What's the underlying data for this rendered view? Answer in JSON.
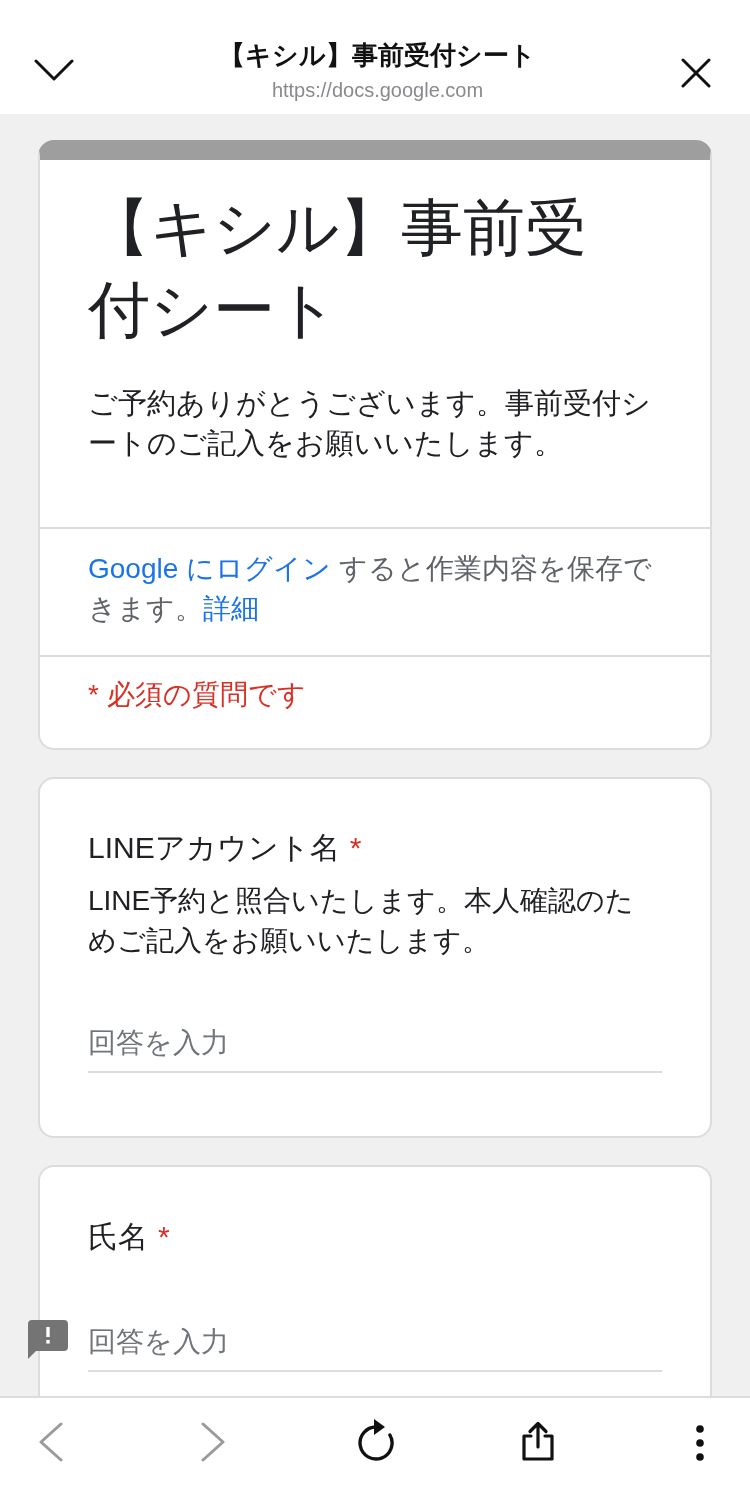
{
  "browser_bar": {
    "page_title": "【キシル】事前受付シート",
    "url": "https://docs.google.com"
  },
  "form_header": {
    "title": "【キシル】事前受付シート",
    "description": "ご予約ありがとうございます。事前受付シートのご記入をお願いいたします。",
    "login_notice": [
      {
        "kind": "link",
        "text": "Google にログイン"
      },
      {
        "kind": "text",
        "text": " すると作業内容を保存できます。"
      },
      {
        "kind": "link",
        "text": "詳細"
      }
    ],
    "required_notice": "* 必須の質問です"
  },
  "questions": [
    {
      "title": "LINEアカウント名",
      "required_mark": "*",
      "description": "LINE予約と照合いたします。本人確認のためご記入をお願いいたします。",
      "placeholder": "回答を入力"
    },
    {
      "title": "氏名",
      "required_mark": "*",
      "placeholder": "回答を入力"
    }
  ],
  "toolbar": [
    {
      "kind": "back",
      "disabled": true
    },
    {
      "kind": "forward",
      "disabled": true
    },
    {
      "kind": "reload",
      "disabled": false
    },
    {
      "kind": "share",
      "disabled": false
    },
    {
      "kind": "more",
      "disabled": false
    }
  ]
}
